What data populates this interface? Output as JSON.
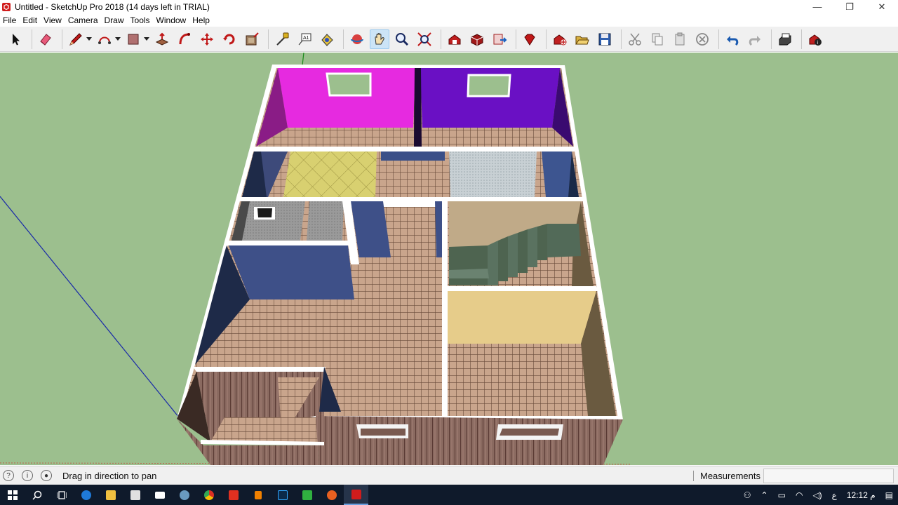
{
  "window": {
    "title": "Untitled - SketchUp Pro 2018 (14 days left in TRIAL)",
    "minimize_glyph": "—",
    "restore_glyph": "❐",
    "close_glyph": "✕"
  },
  "menu": [
    "File",
    "Edit",
    "View",
    "Camera",
    "Draw",
    "Tools",
    "Window",
    "Help"
  ],
  "toolbar": {
    "active_tool": "pan-icon",
    "tools": [
      "select-icon",
      "eraser-icon",
      "pencil-icon",
      "arc-icon",
      "rectangle-icon",
      "push-pull-icon",
      "follow-me-icon",
      "move-icon",
      "rotate-icon",
      "offset-icon",
      "tape-measure-icon",
      "text-icon",
      "paint-bucket-icon",
      "orbit-icon",
      "pan-icon",
      "zoom-icon",
      "zoom-extents-icon",
      "warehouse-icon",
      "extension-warehouse-icon",
      "send-to-layout-icon",
      "ruby-icon",
      "new-icon",
      "open-icon",
      "save-icon",
      "cut-icon",
      "copy-icon",
      "paste-icon",
      "erase-icon",
      "undo-icon",
      "redo-icon",
      "print-icon",
      "model-info-icon"
    ]
  },
  "colors": {
    "sky_ground": "#9cbf8e",
    "accent_active": "#cce4f7",
    "taskbar": "#0f1a2b"
  },
  "status": {
    "hint": "Drag in direction to pan",
    "measurements_label": "Measurements",
    "measurements_value": ""
  },
  "taskbar": {
    "clock": "12:12 م",
    "lang": "ع",
    "apps": [
      "start-icon",
      "search-icon",
      "task-view-icon",
      "edge-icon",
      "file-explorer-icon",
      "store-icon",
      "mail-icon",
      "photos-icon",
      "chrome-icon",
      "app-red-icon",
      "vlc-icon",
      "photoshop-icon",
      "camtasia-icon",
      "firefox-icon",
      "sketchup-icon"
    ]
  }
}
